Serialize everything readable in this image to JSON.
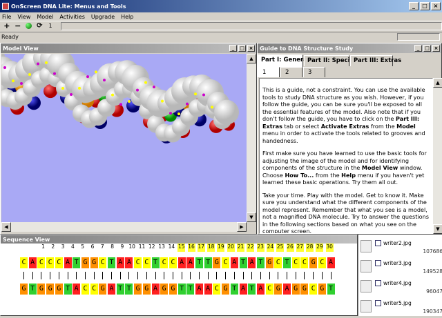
{
  "app": {
    "title": "OnScreen DNA Lite: Menus and Tools",
    "status": "Ready",
    "step_value": "1"
  },
  "menu": [
    "File",
    "View",
    "Model",
    "Activities",
    "Upgrade",
    "Help"
  ],
  "toolbar": {
    "zoom_in": "+",
    "zoom_out": "−",
    "rotate": "⟳"
  },
  "model_view": {
    "title": "Model View",
    "background": "#a9a9f5"
  },
  "guide": {
    "title": "Guide to DNA Structure Study",
    "tabs": [
      "Part I: General",
      "Part II: Specific",
      "Part III: Extras"
    ],
    "subtabs": [
      "1",
      "2",
      "3"
    ],
    "p1_a": "This is a guide, not a constraint. You can use the available tools to study DNA structure as you wish. However, if you follow the guide, you can be sure you'll be exposed to all the essential features of the model. Also note that if you don't follow the guide, you have to click on the ",
    "p1_b": "Part III: Extras",
    "p1_c": " tab or select ",
    "p1_d": "Activate Extras",
    "p1_e": " from the ",
    "p1_f": "Model",
    "p1_g": " menu in order to activate the tools related to grooves and handedness.",
    "p2_a": "First make sure you have learned to use the basic tools for adjusting the image of the model and for identifying components of the structure in the ",
    "p2_b": "Model View",
    "p2_c": " window. Choose ",
    "p2_d": "How To...",
    "p2_e": " from the ",
    "p2_f": "Help",
    "p2_g": " menu if you haven't yet learned these basic operations. Try them all out.",
    "p3": "Take your time. Play with the model. Get to know it. Make sure you understand what the different components of the model represent. Remember that what you see is a model, not a magnified DNA molecule. Try to answer the questions in the following sections based on what you see on the computer screen."
  },
  "sequence_view": {
    "title": "Sequence View",
    "numbers": [
      "1",
      "2",
      "3",
      "4",
      "5",
      "6",
      "7",
      "8",
      "9",
      "10",
      "11",
      "12",
      "13",
      "14",
      "15",
      "16",
      "17",
      "18",
      "19",
      "20",
      "21",
      "22",
      "23",
      "24",
      "25",
      "26",
      "27",
      "28",
      "29",
      "30"
    ],
    "highlight_start": 15,
    "strand1": [
      "C",
      "A",
      "C",
      "C",
      "C",
      "A",
      "T",
      "G",
      "G",
      "C",
      "T",
      "A",
      "A",
      "C",
      "C",
      "T",
      "C",
      "C",
      "A",
      "A",
      "T",
      "T",
      "G",
      "C",
      "A",
      "T",
      "A",
      "T",
      "G",
      "C",
      "T",
      "C",
      "C",
      "G",
      "C",
      "A"
    ],
    "strand2": [
      "G",
      "T",
      "G",
      "G",
      "G",
      "T",
      "A",
      "C",
      "C",
      "G",
      "A",
      "T",
      "T",
      "G",
      "G",
      "A",
      "G",
      "G",
      "T",
      "T",
      "A",
      "A",
      "C",
      "G",
      "T",
      "A",
      "T",
      "A",
      "C",
      "G",
      "A",
      "G",
      "G",
      "C",
      "G",
      "T"
    ],
    "colors": {
      "A": "#ff2020",
      "T": "#30d030",
      "G": "#ff9000",
      "C": "#ffff00",
      "highlight": "#ffff30",
      "base_bg": "#ff00ff"
    }
  },
  "files": [
    {
      "name": "writer2.jpg",
      "size": "107686"
    },
    {
      "name": "writer3.jpg",
      "size": "149528"
    },
    {
      "name": "writer4.jpg",
      "size": "96047"
    },
    {
      "name": "writer5.jpg",
      "size": "190347"
    }
  ]
}
